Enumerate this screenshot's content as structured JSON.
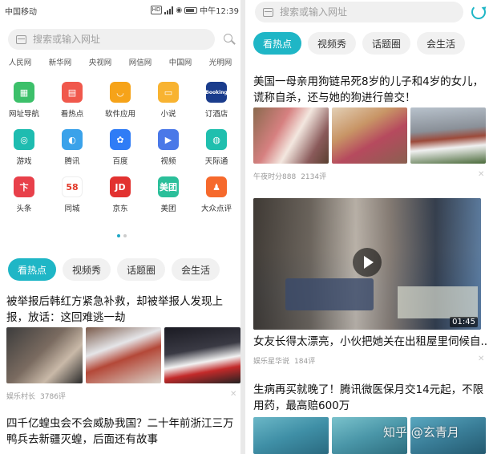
{
  "status_bar": {
    "carrier": "中国移动",
    "time": "中午12:39"
  },
  "left": {
    "search": {
      "placeholder": "搜索或输入网址"
    },
    "site_links": [
      "人民网",
      "新华网",
      "央视网",
      "网信网",
      "中国网",
      "光明网"
    ],
    "apps": [
      {
        "label": "网址导航",
        "icon": "grid-icon",
        "color": "#3cc06a",
        "glyph": "▦"
      },
      {
        "label": "看热点",
        "icon": "news-icon",
        "color": "#f0584c",
        "glyph": "▤"
      },
      {
        "label": "软件应用",
        "icon": "bag-icon",
        "color": "#f6a319",
        "glyph": "◡"
      },
      {
        "label": "小说",
        "icon": "book-icon",
        "color": "#f8b331",
        "glyph": "▭"
      },
      {
        "label": "订酒店",
        "icon": "booking-icon",
        "color": "#1a3c8c",
        "glyph": "Booking"
      },
      {
        "label": "游戏",
        "icon": "gamepad-icon",
        "color": "#1ebcb0",
        "glyph": "◎"
      },
      {
        "label": "腾讯",
        "icon": "tencent-icon",
        "color": "#3aa2ea",
        "glyph": "◐"
      },
      {
        "label": "百度",
        "icon": "baidu-icon",
        "color": "#2f7cf6",
        "glyph": "✿"
      },
      {
        "label": "视频",
        "icon": "play-icon",
        "color": "#4a78e8",
        "glyph": "▶"
      },
      {
        "label": "天际通",
        "icon": "globe-icon",
        "color": "#1fbfae",
        "glyph": "◍"
      },
      {
        "label": "头条",
        "icon": "toutiao-icon",
        "color": "#e8404a",
        "glyph": "卞"
      },
      {
        "label": "同城",
        "icon": "58-icon",
        "color": "#ffffff",
        "glyph": "58"
      },
      {
        "label": "京东",
        "icon": "jd-icon",
        "color": "#e23230",
        "glyph": "JD"
      },
      {
        "label": "美团",
        "icon": "meituan-icon",
        "color": "#2bbf9a",
        "glyph": "美团"
      },
      {
        "label": "大众点评",
        "icon": "dianping-icon",
        "color": "#f6692c",
        "glyph": "♟"
      }
    ],
    "tabs": [
      "看热点",
      "视频秀",
      "话题圈",
      "会生活"
    ],
    "article1": {
      "headline": "被举报后韩红方紧急补救，却被举报人发现上报，放话：这回难逃一劫",
      "source": "娱乐村长",
      "comments": "3786评"
    },
    "article2": {
      "headline": "四千亿蝗虫会不会威胁我国？二十年前浙江三万鸭兵去新疆灭蝗，后面还有故事"
    }
  },
  "right": {
    "search": {
      "placeholder": "搜索或输入网址"
    },
    "tabs": [
      "看热点",
      "视频秀",
      "话题圈",
      "会生活"
    ],
    "article1": {
      "headline": "美国一母亲用狗链吊死8岁的儿子和4岁的女儿，谎称自杀，还与她的狗进行兽交！",
      "source": "午夜时分888",
      "comments": "2134评"
    },
    "video": {
      "duration": "01:45",
      "headline": "女友长得太漂亮，小伙把她关在出租屋里伺候自...",
      "source": "娱乐星华说",
      "comments": "184评"
    },
    "article3": {
      "headline": "生病再买就晚了！腾讯微医保月交14元起，不限用药，最高赔600万"
    }
  },
  "watermark": "知乎 @玄青月",
  "colors": {
    "accent": "#1fb6c6"
  }
}
